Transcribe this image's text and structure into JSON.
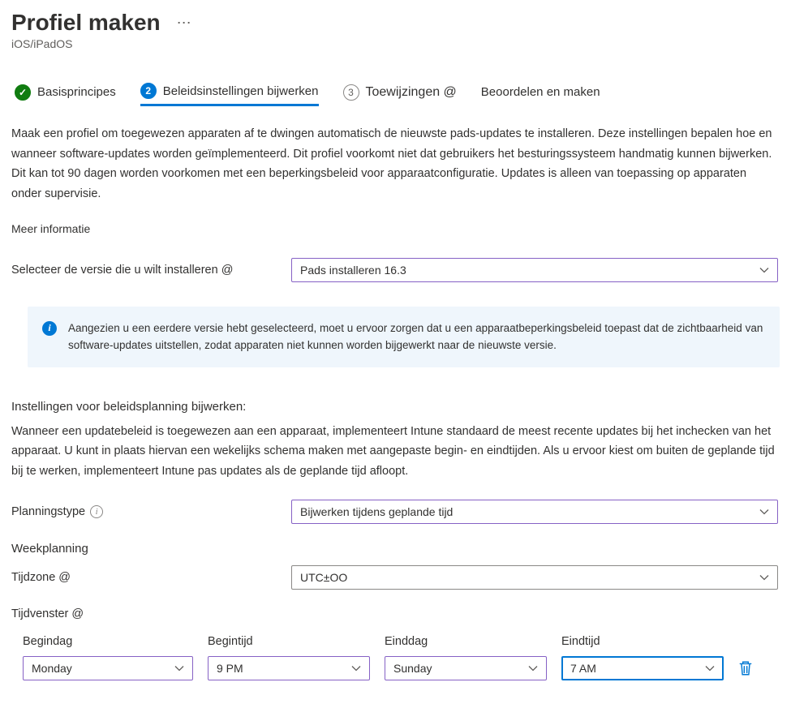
{
  "header": {
    "title": "Profiel maken",
    "subtitle": "iOS/iPadOS"
  },
  "steps": {
    "basics": "Basisprincipes",
    "update_settings": "Beleidsinstellingen bijwerken",
    "assignments": "Toewijzingen @",
    "review_create": "Beoordelen en maken",
    "step3_num": "3"
  },
  "intro": "Maak een profiel om toegewezen apparaten af te dwingen automatisch de nieuwste pads-updates te installeren. Deze instellingen bepalen hoe en wanneer software-updates worden geïmplementeerd. Dit profiel voorkomt niet dat gebruikers het besturingssysteem handmatig kunnen bijwerken. Dit kan tot 90 dagen worden voorkomen met een beperkingsbeleid voor apparaatconfiguratie. Updates is alleen van toepassing op apparaten onder supervisie.",
  "more_info": "Meer informatie",
  "version": {
    "label": "Selecteer de versie die u wilt installeren @",
    "value": "Pads installeren 16.3"
  },
  "info_box": "Aangezien u een eerdere versie hebt geselecteerd, moet u ervoor zorgen dat u een apparaatbeperkingsbeleid toepast dat de zichtbaarheid van software-updates uitstellen, zodat apparaten niet kunnen worden bijgewerkt naar de nieuwste versie.",
  "schedule": {
    "heading": "Instellingen voor beleidsplanning bijwerken:",
    "body": "Wanneer een updatebeleid is toegewezen aan een apparaat, implementeert Intune standaard de meest recente updates bij het inchecken van het apparaat. U kunt in plaats hiervan een wekelijks schema maken met aangepaste begin- en eindtijden. Als u ervoor kiest om buiten de geplande tijd bij te werken, implementeert Intune pas updates als de geplande tijd afloopt.",
    "type_label": "Planningstype",
    "type_value": "Bijwerken tijdens geplande tijd",
    "weekly_heading": "Weekplanning",
    "timezone_label": "Tijdzone @",
    "timezone_value": "UTC±OO",
    "timewindow_label": "Tijdvenster @"
  },
  "time_table": {
    "headers": {
      "start_day": "Begindag",
      "start_time": "Begintijd",
      "end_day": "Einddag",
      "end_time": "Eindtijd"
    },
    "row": {
      "start_day": "Monday",
      "start_time": "9 PM",
      "end_day": "Sunday",
      "end_time": "7 AM"
    }
  }
}
